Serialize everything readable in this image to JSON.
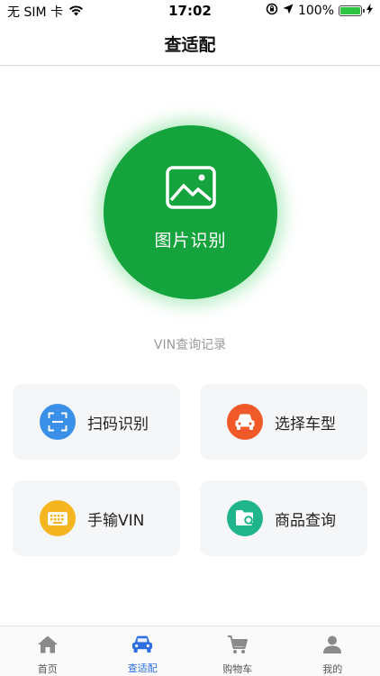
{
  "status_bar": {
    "carrier": "无 SIM 卡",
    "time": "17:02",
    "battery": "100%",
    "battery_level": 1.0
  },
  "header": {
    "title": "查适配"
  },
  "main": {
    "recognize_button": {
      "label": "图片识别",
      "icon": "image-icon"
    },
    "vin_history_link": "VIN查询记录",
    "actions": [
      {
        "label": "扫码识别",
        "icon": "scan-icon",
        "color": "#3a8fe8"
      },
      {
        "label": "选择车型",
        "icon": "car-icon",
        "color": "#f05a28"
      },
      {
        "label": "手输VIN",
        "icon": "keyboard-icon",
        "color": "#f5b520"
      },
      {
        "label": "商品查询",
        "icon": "folder-search-icon",
        "color": "#1fb48a"
      }
    ]
  },
  "tab_bar": {
    "tabs": [
      {
        "label": "首页",
        "icon": "home-icon"
      },
      {
        "label": "查适配",
        "icon": "car-icon",
        "active": true
      },
      {
        "label": "购物车",
        "icon": "cart-icon"
      },
      {
        "label": "我的",
        "icon": "person-icon"
      }
    ]
  },
  "colors": {
    "primary_green": "#15a33d",
    "accent_blue": "#2d6fe0"
  }
}
